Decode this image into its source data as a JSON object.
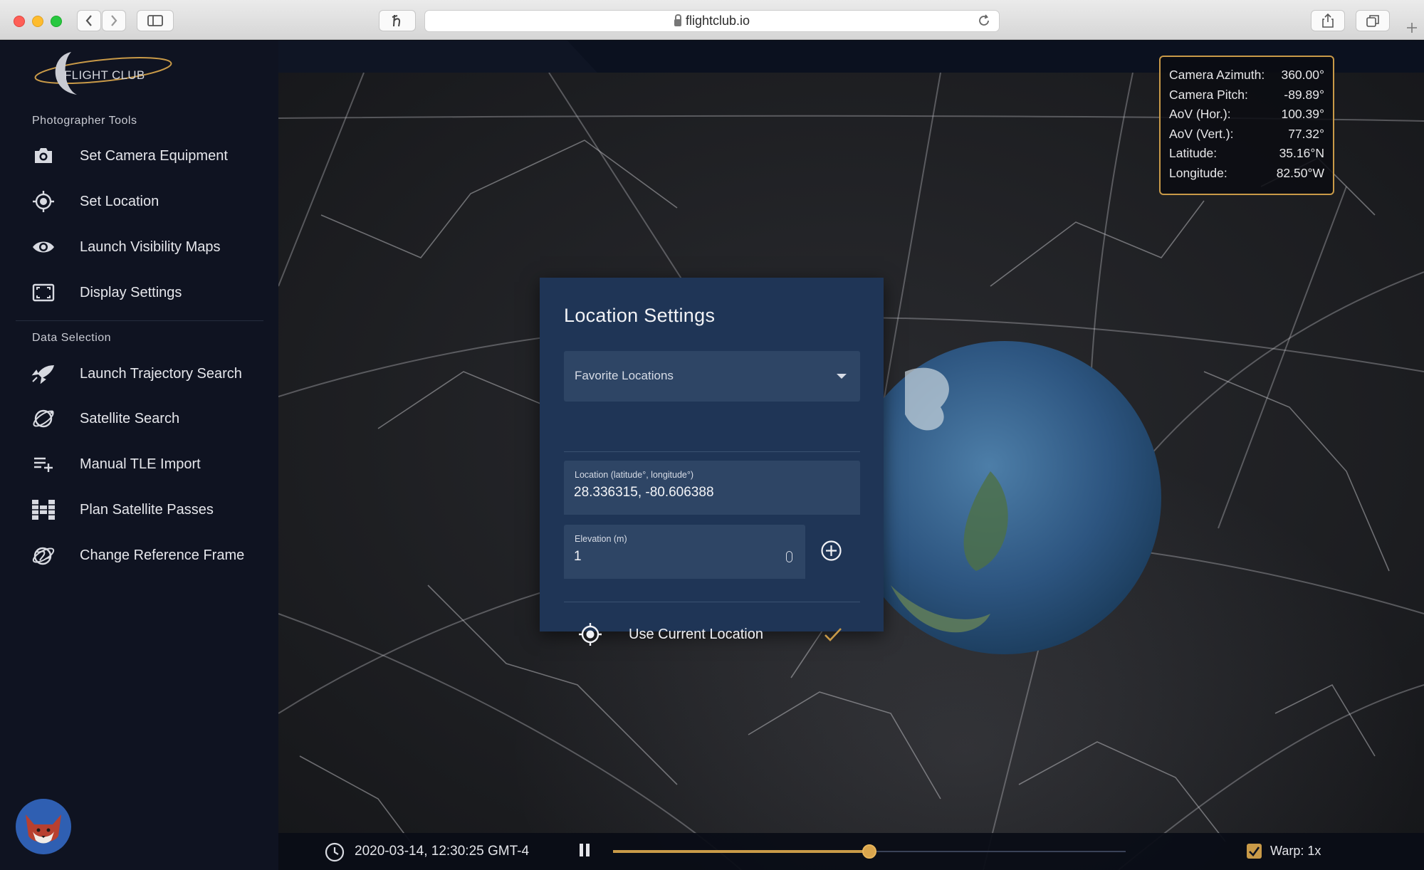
{
  "browser": {
    "url": "flightclub.io",
    "back_icon": "chevron-left",
    "forward_icon": "chevron-right",
    "sidebar_toggle_icon": "sidebar",
    "extension_icon": "h-script",
    "reload_icon": "reload",
    "share_icon": "share",
    "tabs_icon": "tabs",
    "new_tab_icon": "plus"
  },
  "logo": {
    "text": "FLIGHT CLUB"
  },
  "sidebar": {
    "photographer_title": "Photographer Tools",
    "photographer_items": [
      {
        "label": "Set Camera Equipment",
        "icon": "camera-icon"
      },
      {
        "label": "Set Location",
        "icon": "crosshair-icon"
      },
      {
        "label": "Launch Visibility Maps",
        "icon": "eye-icon"
      },
      {
        "label": "Display Settings",
        "icon": "display-icon"
      }
    ],
    "data_title": "Data Selection",
    "data_items": [
      {
        "label": "Launch Trajectory Search",
        "icon": "rocket-icon"
      },
      {
        "label": "Satellite Search",
        "icon": "orbit-icon"
      },
      {
        "label": "Manual TLE Import",
        "icon": "playlist-add-icon"
      },
      {
        "label": "Plan Satellite Passes",
        "icon": "satellite-icon"
      },
      {
        "label": "Change Reference Frame",
        "icon": "globe-orbit-icon"
      }
    ]
  },
  "camera_info": {
    "rows": [
      {
        "label": "Camera Azimuth:",
        "value": "360.00°"
      },
      {
        "label": "Camera Pitch:",
        "value": "-89.89°"
      },
      {
        "label": "AoV (Hor.):",
        "value": "100.39°"
      },
      {
        "label": "AoV (Vert.):",
        "value": "77.32°"
      },
      {
        "label": "Latitude:",
        "value": "35.16°N"
      },
      {
        "label": "Longitude:",
        "value": "82.50°W"
      }
    ]
  },
  "modal": {
    "title": "Location Settings",
    "favorites_placeholder": "Favorite Locations",
    "location_label": "Location (latitude°, longitude°)",
    "location_value": "28.336315, -80.606388",
    "elevation_label": "Elevation (m)",
    "elevation_value": "1",
    "use_current_label": "Use Current Location"
  },
  "timeline": {
    "datetime": "2020-03-14, 12:30:25 GMT-4",
    "progress": 0.5,
    "warp_label": "Warp: 1x",
    "warp_checked": true
  },
  "colors": {
    "accent": "#c99a48",
    "sidebar_bg": "#0f1321",
    "modal_bg": "#1f3556",
    "field_bg": "#2e4565"
  }
}
